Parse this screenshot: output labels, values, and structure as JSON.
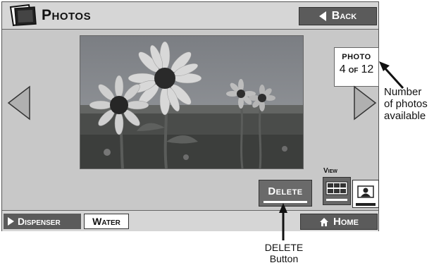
{
  "header": {
    "title": "Photos",
    "back_label": "Back"
  },
  "photo_counter": {
    "label": "PHOTO",
    "current": "4",
    "of": "OF",
    "total": "12"
  },
  "actions": {
    "delete_label": "Delete",
    "view_label": "View"
  },
  "footer": {
    "dispenser_label": "Dispenser",
    "water_label": "Water",
    "home_label": "Home"
  },
  "callouts": {
    "photos_line1": "Number",
    "photos_line2": "of photos",
    "photos_line3": "available",
    "delete_line1": "DELETE",
    "delete_line2": "Button"
  },
  "icons": {
    "title_icon": "photos-icon",
    "back_icon": "left-triangle-icon",
    "prev_icon": "left-arrow-icon",
    "next_icon": "right-arrow-icon",
    "grid_icon": "grid-view-icon",
    "single_icon": "single-view-icon",
    "home_icon": "home-icon",
    "dispenser_icon": "right-triangle-icon"
  },
  "colors": {
    "screen_bg": "#c8c8c8",
    "button_dark": "#5b5b5b",
    "panel_white": "#ffffff"
  }
}
